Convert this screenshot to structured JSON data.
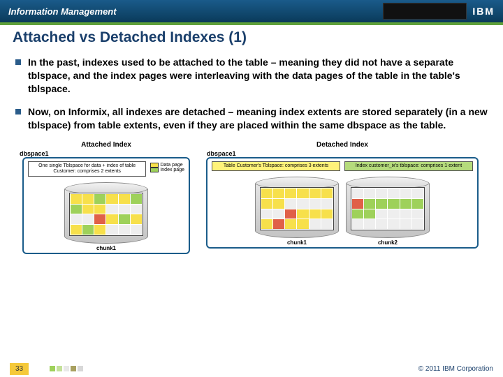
{
  "header": {
    "product": "Information Management",
    "logo": "IBM"
  },
  "title": "Attached vs Detached Indexes (1)",
  "bullets": [
    "In the past, indexes used to be attached to the table – meaning they did not have a separate tblspace, and the index pages were interleaving with the data pages of the table in the table's tblspace.",
    "Now, on Informix, all indexes are detached – meaning index extents are stored separately (in a new tblspace) from table extents, even if they are placed within the same dbspace as the table."
  ],
  "diagrams": {
    "attached": {
      "title": "Attached Index",
      "dbspace": "dbspace1",
      "tblspace": "One single Tblspace for data + index of table Customer: comprises 2 extents",
      "legend_data": "Data page",
      "legend_index": "Index page",
      "chunk": "chunk1"
    },
    "detached": {
      "title": "Detached Index",
      "dbspace": "dbspace1",
      "tbl1": "Table Customer's Tblspace: comprises 3 extents",
      "tbl2": "Index customer_ix's tblspace: comprises 1 extent",
      "chunk1": "chunk1",
      "chunk2": "chunk2"
    }
  },
  "footer": {
    "page": "33",
    "copyright": "© 2011 IBM Corporation"
  }
}
